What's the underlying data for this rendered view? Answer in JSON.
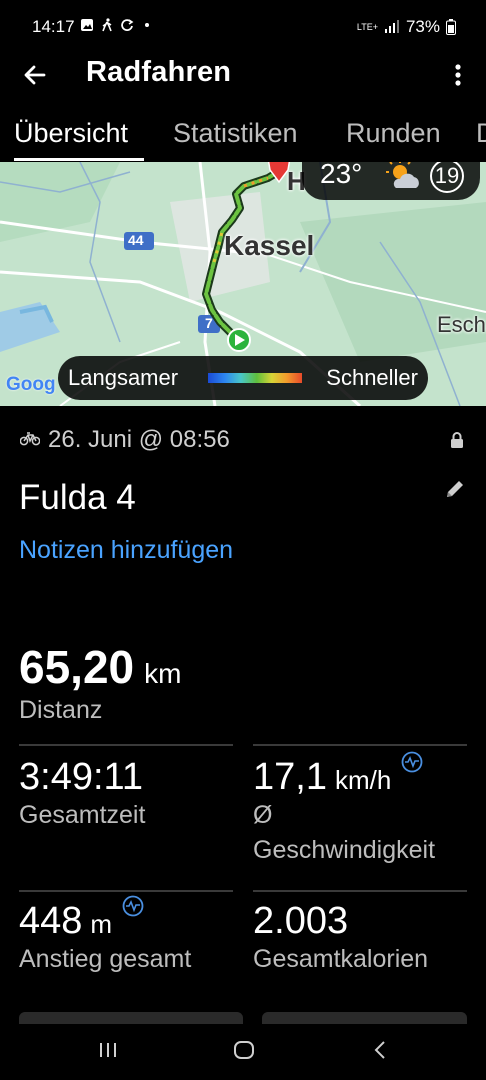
{
  "status_bar": {
    "time": "14:17",
    "network": "LTE+",
    "battery": "73%"
  },
  "app_bar": {
    "title": "Radfahren"
  },
  "tabs": [
    {
      "label": "Übersicht",
      "active": true
    },
    {
      "label": "Statistiken",
      "active": false
    },
    {
      "label": "Runden",
      "active": false
    },
    {
      "label": "D",
      "active": false
    }
  ],
  "map": {
    "weather_temp": "23°",
    "weather_icon": "partly-cloudy-icon",
    "aqi_value": "19",
    "city_main": "Kassel",
    "city_partial_left": "H",
    "city_partial_right": "Esch",
    "road_label_1": "44",
    "road_label_2": "7",
    "legend_slow": "Langsamer",
    "legend_fast": "Schneller",
    "attribution": "Goog"
  },
  "activity": {
    "date": "26. Juni @ 08:56",
    "name": "Fulda 4",
    "add_notes": "Notizen hinzufügen"
  },
  "stats": {
    "distance": {
      "value": "65,20",
      "unit": "km",
      "label": "Distanz"
    },
    "total_time": {
      "value": "3:49:11",
      "label": "Gesamtzeit"
    },
    "avg_speed": {
      "value": "17,1",
      "unit": "km/h",
      "label_1": "Ø",
      "label_2": "Geschwindigkeit"
    },
    "ascent": {
      "value": "448",
      "unit": "m",
      "label": "Anstieg gesamt"
    },
    "calories": {
      "value": "2.003",
      "label": "Gesamtkalorien"
    }
  },
  "colors": {
    "accent_link": "#4aa3ff",
    "route_start": "#2bb33c",
    "route_end": "#e53935"
  }
}
